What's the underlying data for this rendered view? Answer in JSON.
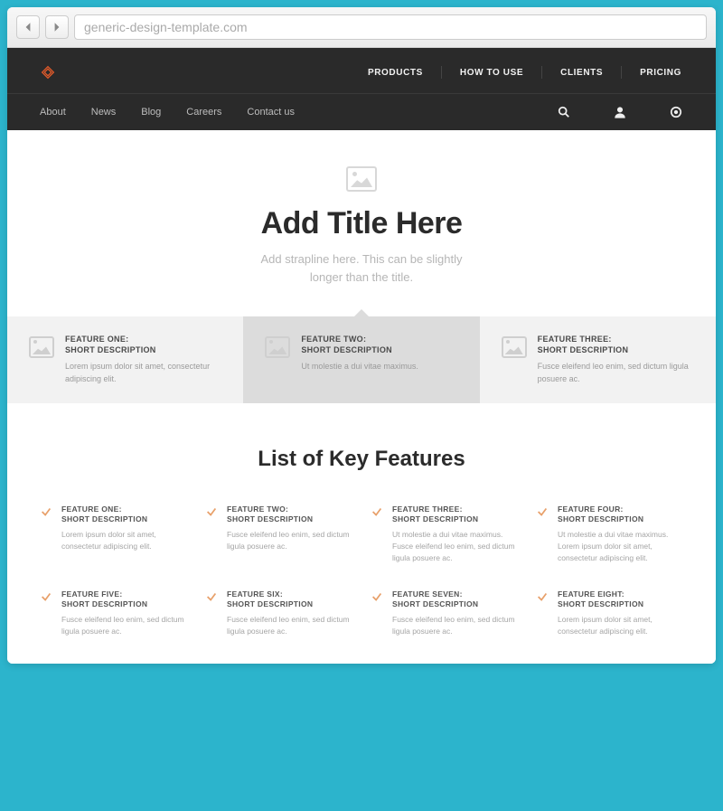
{
  "browser": {
    "url": "generic-design-template.com"
  },
  "nav": {
    "primary": [
      "PRODUCTS",
      "HOW TO USE",
      "CLIENTS",
      "PRICING"
    ],
    "secondary": [
      "About",
      "News",
      "Blog",
      "Careers",
      "Contact us"
    ]
  },
  "hero": {
    "title": "Add Title Here",
    "strapline": "Add strapline here. This can be slightly longer than the title."
  },
  "feature_cards": [
    {
      "title": "FEATURE ONE:\nSHORT DESCRIPTION",
      "desc": "Lorem ipsum dolor sit amet, consectetur adipiscing elit.",
      "active": false
    },
    {
      "title": "FEATURE TWO:\nSHORT DESCRIPTION",
      "desc": "Ut molestie a dui vitae maximus.",
      "active": true
    },
    {
      "title": "FEATURE THREE:\nSHORT DESCRIPTION",
      "desc": "Fusce eleifend leo enim, sed dictum ligula posuere ac.",
      "active": false
    }
  ],
  "key_features": {
    "heading": "List of Key Features",
    "items": [
      {
        "title": "FEATURE ONE:\nSHORT DESCRIPTION",
        "desc": "Lorem ipsum dolor sit amet, consectetur adipiscing elit."
      },
      {
        "title": "FEATURE TWO:\nSHORT DESCRIPTION",
        "desc": "Fusce eleifend leo enim, sed dictum ligula posuere ac."
      },
      {
        "title": "FEATURE THREE:\nSHORT DESCRIPTION",
        "desc": "Ut molestie a dui vitae maximus. Fusce eleifend leo enim, sed dictum ligula posuere ac."
      },
      {
        "title": "FEATURE FOUR:\nSHORT DESCRIPTION",
        "desc": "Ut molestie a dui vitae maximus. Lorem ipsum dolor sit amet, consectetur adipiscing elit."
      },
      {
        "title": "FEATURE FIVE:\nSHORT DESCRIPTION",
        "desc": "Fusce eleifend leo enim, sed dictum ligula posuere ac."
      },
      {
        "title": "FEATURE SIX:\nSHORT DESCRIPTION",
        "desc": "Fusce eleifend leo enim, sed dictum ligula posuere ac."
      },
      {
        "title": "FEATURE SEVEN:\nSHORT DESCRIPTION",
        "desc": "Fusce eleifend leo enim, sed dictum ligula posuere ac."
      },
      {
        "title": "FEATURE EIGHT:\nSHORT DESCRIPTION",
        "desc": "Lorem ipsum dolor sit amet, consectetur adipiscing elit."
      }
    ]
  }
}
